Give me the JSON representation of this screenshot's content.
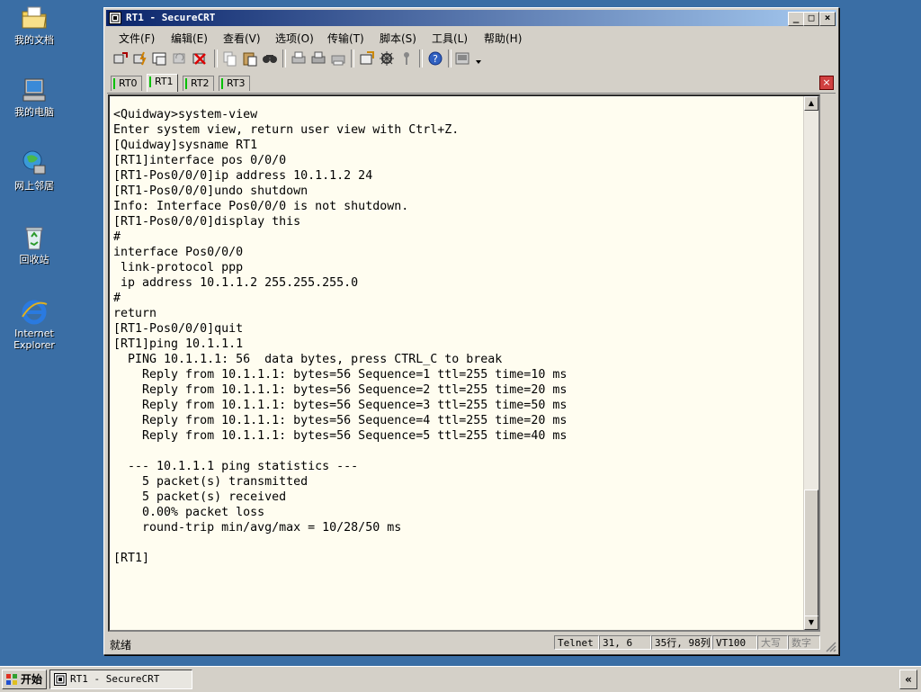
{
  "desktop": {
    "icons": [
      {
        "label": "我的文档",
        "icon": "folder-icon"
      },
      {
        "label": "我的电脑",
        "icon": "computer-icon"
      },
      {
        "label": "网上邻居",
        "icon": "network-icon"
      },
      {
        "label": "回收站",
        "icon": "recycle-bin-icon"
      },
      {
        "label": "Internet Explorer",
        "label1": "Internet",
        "label2": "Explorer",
        "icon": "ie-icon"
      }
    ]
  },
  "window": {
    "title": "RT1 - SecureCRT",
    "controls": {
      "minimize": "_",
      "maximize": "□",
      "close": "×"
    }
  },
  "menu": {
    "items": [
      "文件(F)",
      "编辑(E)",
      "查看(V)",
      "选项(O)",
      "传输(T)",
      "脚本(S)",
      "工具(L)",
      "帮助(H)"
    ]
  },
  "tabs": {
    "items": [
      "RT0",
      "RT1",
      "RT2",
      "RT3"
    ],
    "active": "RT1",
    "close_label": "×"
  },
  "terminal": {
    "lines": [
      "<Quidway>system-view",
      "Enter system view, return user view with Ctrl+Z.",
      "[Quidway]sysname RT1",
      "[RT1]interface pos 0/0/0",
      "[RT1-Pos0/0/0]ip address 10.1.1.2 24",
      "[RT1-Pos0/0/0]undo shutdown",
      "Info: Interface Pos0/0/0 is not shutdown.",
      "[RT1-Pos0/0/0]display this",
      "#",
      "interface Pos0/0/0",
      " link-protocol ppp",
      " ip address 10.1.1.2 255.255.255.0",
      "#",
      "return",
      "[RT1-Pos0/0/0]quit",
      "[RT1]ping 10.1.1.1",
      "  PING 10.1.1.1: 56  data bytes, press CTRL_C to break",
      "    Reply from 10.1.1.1: bytes=56 Sequence=1 ttl=255 time=10 ms",
      "    Reply from 10.1.1.1: bytes=56 Sequence=2 ttl=255 time=20 ms",
      "    Reply from 10.1.1.1: bytes=56 Sequence=3 ttl=255 time=50 ms",
      "    Reply from 10.1.1.1: bytes=56 Sequence=4 ttl=255 time=20 ms",
      "    Reply from 10.1.1.1: bytes=56 Sequence=5 ttl=255 time=40 ms",
      "",
      "  --- 10.1.1.1 ping statistics ---",
      "    5 packet(s) transmitted",
      "    5 packet(s) received",
      "    0.00% packet loss",
      "    round-trip min/avg/max = 10/28/50 ms",
      "",
      "[RT1]"
    ]
  },
  "statusbar": {
    "ready": "就绪",
    "protocol": "Telnet",
    "cursor": "31,   6",
    "size": "35行, 98列",
    "emulation": "VT100",
    "caps": "大写",
    "num": "数字"
  },
  "taskbar": {
    "start": "开始",
    "task": "RT1 - SecureCRT",
    "tray_toggle": "«"
  },
  "colors": {
    "desktop": "#3a6ea5",
    "titlebar_start": "#0a246a",
    "titlebar_end": "#a6caf0",
    "terminal_bg": "#fffdf0",
    "tab_indicator": "#00c000"
  }
}
